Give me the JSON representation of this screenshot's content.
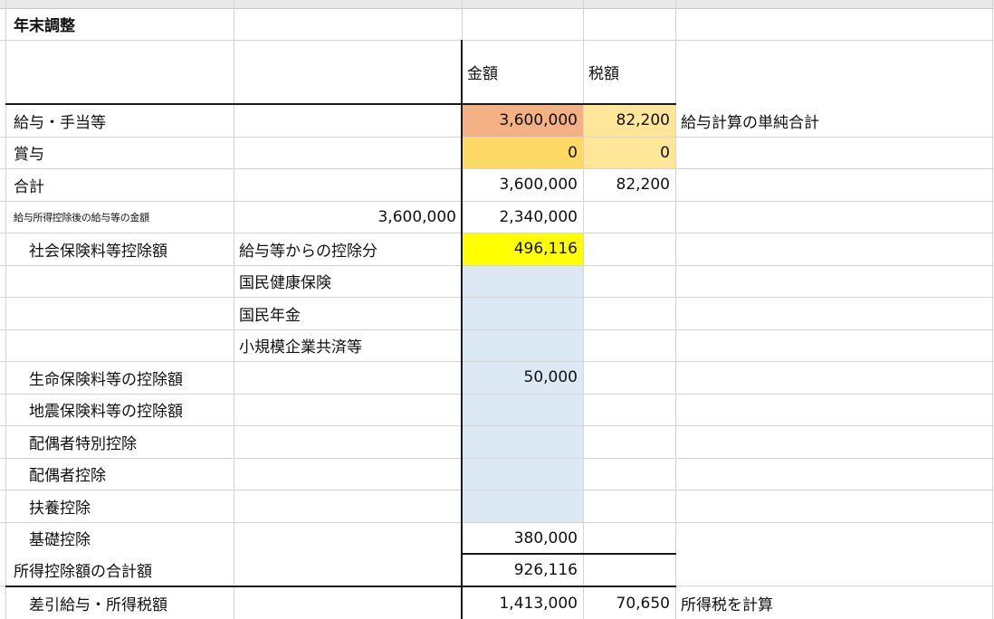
{
  "sheet": {
    "title": "年末調整",
    "headers": {
      "amount": "金額",
      "tax": "税額"
    },
    "colors": {
      "salary_amount_fill": "#f4b183",
      "salary_tax_fill": "#ffe699",
      "bonus_amount_fill": "#ffd966",
      "bonus_tax_fill": "#ffe699",
      "social_fill": "#ffff00",
      "input_block_fill": "#dde8f5",
      "border_dark": "#1a1a1a",
      "gridline": "#d4d4d4"
    },
    "rows": {
      "salary": {
        "label": "給与・手当等",
        "amount": "3,600,000",
        "tax": "82,200",
        "note": "給与計算の単純合計"
      },
      "bonus": {
        "label": "賞与",
        "amount": "0",
        "tax": "0"
      },
      "total": {
        "label": "合計",
        "amount": "3,600,000",
        "tax": "82,200"
      },
      "after_deduction": {
        "label": "給与所得控除後の給与等の金額",
        "input": "3,600,000",
        "amount": "2,340,000"
      },
      "social": {
        "label": "社会保険料等控除額",
        "sublabel": "給与等からの控除分",
        "amount": "496,116"
      },
      "health": {
        "sublabel": "国民健康保険"
      },
      "pension": {
        "sublabel": "国民年金"
      },
      "mutual": {
        "sublabel": "小規模企業共済等"
      },
      "life": {
        "label": "生命保険料等の控除額",
        "amount": "50,000"
      },
      "earthquake": {
        "label": "地震保険料等の控除額"
      },
      "spouse_special": {
        "label": "配偶者特別控除"
      },
      "spouse": {
        "label": "配偶者控除"
      },
      "dependents": {
        "label": "扶養控除"
      },
      "basic": {
        "label": "基礎控除",
        "amount": "380,000"
      },
      "deduction_total": {
        "label": "所得控除額の合計額",
        "amount": "926,116"
      },
      "taxable": {
        "label": "差引給与・所得税額",
        "amount": "1,413,000",
        "tax": "70,650",
        "note": "所得税を計算"
      }
    }
  }
}
